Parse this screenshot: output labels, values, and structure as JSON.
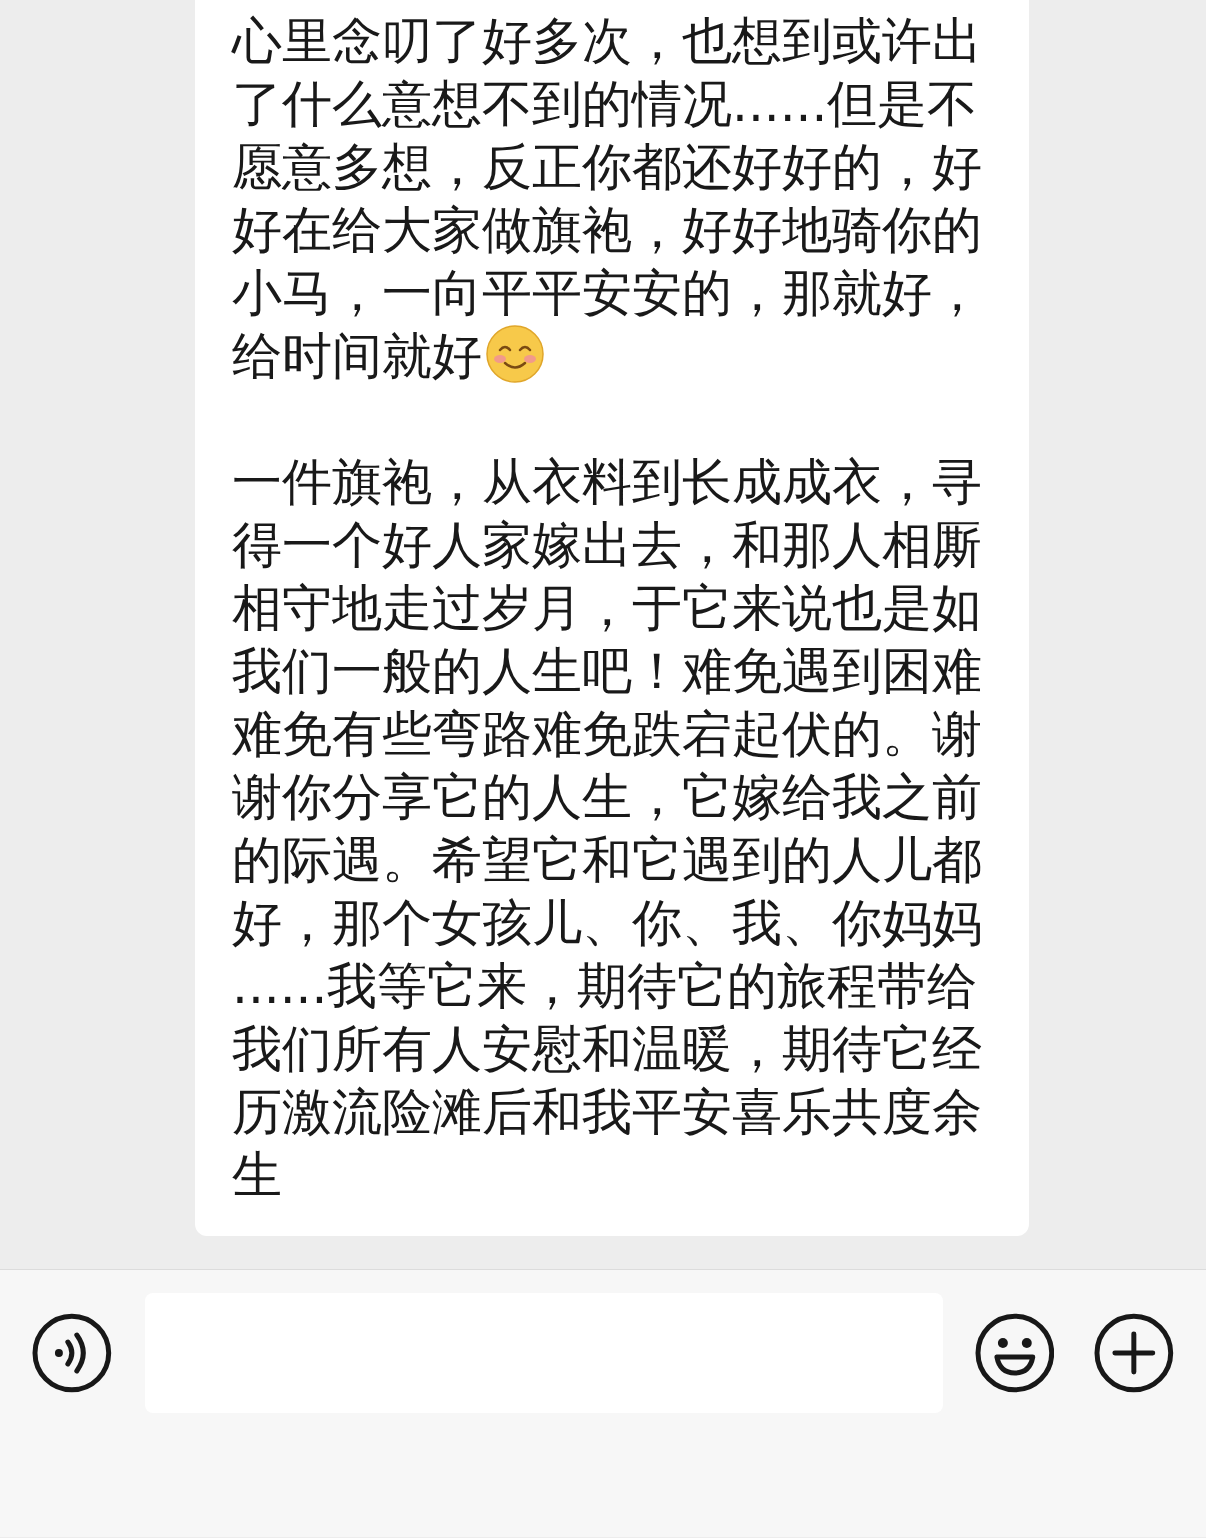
{
  "message": {
    "paragraphs": [
      {
        "text": "心里念叨了好多次，也想到或许出了什么意想不到的情况......但是不愿意多想，反正你都还好好的，好好在给大家做旗袍，好好地骑你的小马，一向平平安安的，那就好，给时间就好",
        "ends_with_emoji": true
      },
      {
        "text": "一件旗袍，从衣料到长成成衣，寻得一个好人家嫁出去，和那人相厮相守地走过岁月，于它来说也是如我们一般的人生吧！难免遇到困难难免有些弯路难免跌宕起伏的。谢谢你分享它的人生，它嫁给我之前的际遇。希望它和它遇到的人儿都好，那个女孩儿、你、我、你妈妈......我等它来，期待它的旅程带给我们所有人安慰和温暖，期待它经历激流险滩后和我平安喜乐共度余生",
        "ends_with_emoji": false
      }
    ]
  }
}
